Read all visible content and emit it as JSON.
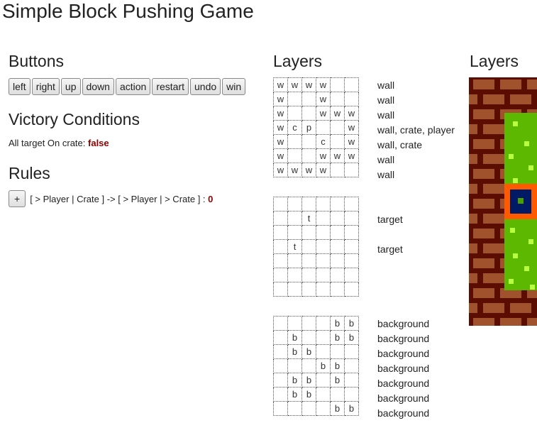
{
  "title": "Simple Block Pushing Game",
  "buttons": {
    "heading": "Buttons",
    "items": [
      {
        "label": "left"
      },
      {
        "label": "right"
      },
      {
        "label": "up"
      },
      {
        "label": "down"
      },
      {
        "label": "action"
      },
      {
        "label": "restart"
      },
      {
        "label": "undo"
      },
      {
        "label": "win"
      }
    ]
  },
  "victory": {
    "heading": "Victory Conditions",
    "text": "All target On crate:",
    "value": "false"
  },
  "rules": {
    "heading": "Rules",
    "add_label": "+",
    "text": "[ > Player | Crate ] -> [ > Player | > Crate ] :",
    "count": "0"
  },
  "layers_text": {
    "heading": "Layers",
    "layers": [
      {
        "rows": [
          [
            "w",
            "w",
            "w",
            "w",
            "",
            ""
          ],
          [
            "w",
            "",
            "",
            "w",
            "",
            ""
          ],
          [
            "w",
            "",
            "",
            "w",
            "w",
            "w"
          ],
          [
            "w",
            "c",
            "p",
            "",
            "",
            "w"
          ],
          [
            "w",
            "",
            "",
            "c",
            "",
            "w"
          ],
          [
            "w",
            "",
            "",
            "w",
            "w",
            "w"
          ],
          [
            "w",
            "w",
            "w",
            "w",
            "",
            ""
          ]
        ],
        "labels": [
          "wall",
          "wall",
          "wall",
          "wall, crate, player",
          "wall, crate",
          "wall",
          "wall"
        ]
      },
      {
        "rows": [
          [
            "",
            "",
            "",
            "",
            "",
            ""
          ],
          [
            "",
            "",
            "t",
            "",
            "",
            ""
          ],
          [
            "",
            "",
            "",
            "",
            "",
            ""
          ],
          [
            "",
            "t",
            "",
            "",
            "",
            ""
          ],
          [
            "",
            "",
            "",
            "",
            "",
            ""
          ],
          [
            "",
            "",
            "",
            "",
            "",
            ""
          ],
          [
            "",
            "",
            "",
            "",
            "",
            ""
          ]
        ],
        "labels": [
          "",
          "target",
          "",
          "target",
          "",
          "",
          ""
        ]
      },
      {
        "rows": [
          [
            "",
            "",
            "",
            "",
            "b",
            "b"
          ],
          [
            "",
            "b",
            "",
            "",
            "b",
            "b"
          ],
          [
            "",
            "b",
            "b",
            "",
            "",
            ""
          ],
          [
            "",
            "",
            "",
            "b",
            "b",
            ""
          ],
          [
            "",
            "b",
            "b",
            "",
            "b",
            ""
          ],
          [
            "",
            "b",
            "b",
            "",
            "",
            ""
          ],
          [
            "",
            "",
            "",
            "",
            "b",
            "b"
          ]
        ],
        "labels": [
          "background",
          "background",
          "background",
          "background",
          "background",
          "background",
          "background"
        ]
      }
    ]
  },
  "layers_visual": {
    "heading": "Layers",
    "colors": {
      "brick": "#a0522d",
      "mortar": "#5a0d00",
      "grass": "#5cb800",
      "grass_speck": "#b8ff40",
      "crate_border": "#ff5a00",
      "crate_inner": "#001a66",
      "crate_core": "#4aa000"
    }
  }
}
